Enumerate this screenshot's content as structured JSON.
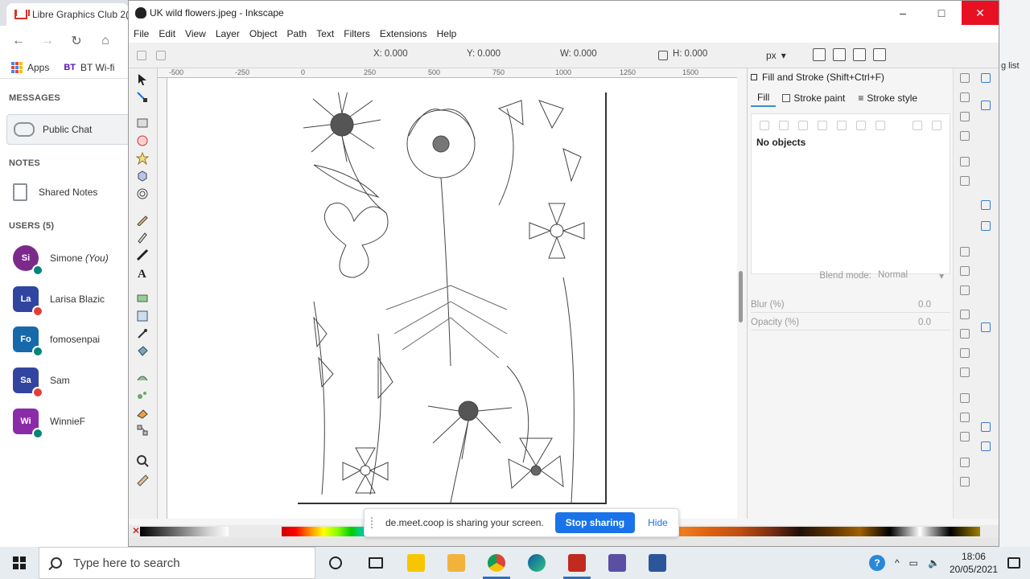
{
  "browser": {
    "tab_title": "Libre Graphics Club 2(",
    "bookmarks": [
      {
        "label": "Apps"
      },
      {
        "label": "BT Wi-fi",
        "badge": "BT"
      }
    ],
    "right_edge_text": "g list"
  },
  "sidebar": {
    "messages_heading": "MESSAGES",
    "public_chat": "Public Chat",
    "notes_heading": "NOTES",
    "shared_notes": "Shared Notes",
    "users_heading": "USERS (5)",
    "users": [
      {
        "initials": "Si",
        "name": "Simone",
        "suffix": "(You)",
        "color": "#7b2a8c",
        "badge_color": "#00857c"
      },
      {
        "initials": "La",
        "name": "Larisa Blazic",
        "suffix": "",
        "color": "#3145a0",
        "badge_color": "#e0403a"
      },
      {
        "initials": "Fo",
        "name": "fomosenpai",
        "suffix": "",
        "color": "#1769aa",
        "badge_color": "#00857c"
      },
      {
        "initials": "Sa",
        "name": "Sam",
        "suffix": "",
        "color": "#3145a0",
        "badge_color": "#e0403a"
      },
      {
        "initials": "Wi",
        "name": "WinnieF",
        "suffix": "",
        "color": "#8a2ba8",
        "badge_color": "#00857c"
      }
    ]
  },
  "inkscape": {
    "title": "UK wild flowers.jpeg - Inkscape",
    "menu": [
      "File",
      "Edit",
      "View",
      "Layer",
      "Object",
      "Path",
      "Text",
      "Filters",
      "Extensions",
      "Help"
    ],
    "toolbar": {
      "x_label": "X:",
      "x_value": "0.000",
      "y_label": "Y:",
      "y_value": "0.000",
      "w_label": "W:",
      "w_value": "0.000",
      "h_label": "H:",
      "h_value": "0.000",
      "unit": "px"
    },
    "ruler_labels": [
      "-500",
      "-250",
      "0",
      "250",
      "500",
      "750",
      "1000",
      "1250",
      "1500"
    ],
    "fill_stroke": {
      "title": "Fill and Stroke (Shift+Ctrl+F)",
      "tabs": [
        "Fill",
        "Stroke paint",
        "Stroke style"
      ],
      "message": "No objects",
      "blend_label": "Blend mode:",
      "blend_value": "Normal",
      "blur_label": "Blur (%)",
      "blur_value": "0.0",
      "opacity_label": "Opacity (%)",
      "opacity_value": "0.0"
    }
  },
  "share": {
    "message": "de.meet.coop is sharing your screen.",
    "stop_label": "Stop sharing",
    "hide_label": "Hide"
  },
  "taskbar": {
    "search_placeholder": "Type here to search",
    "time": "18:06",
    "date": "20/05/2021"
  }
}
